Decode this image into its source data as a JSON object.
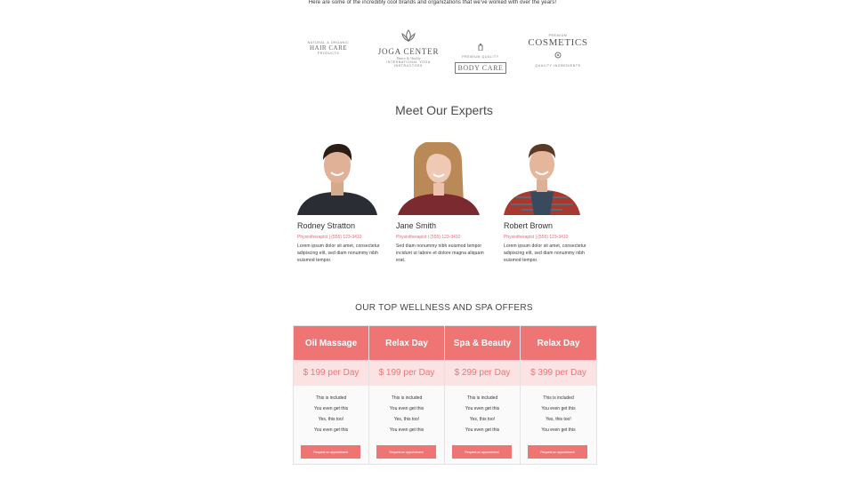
{
  "intro": {
    "text": "Here are some of the incredibly cool brands and organizations that we've worked with over the years!"
  },
  "brands": {
    "hair_care": {
      "top": "NATURAL & ORGANIC",
      "main": "HAIR CARE",
      "bottom": "PRODUCTS"
    },
    "joga_center": {
      "main": "JOGA CENTER",
      "script": "Dance & Vitality",
      "bottom": "INTERNATIONAL YOGA INSTRUCTORS"
    },
    "body_care": {
      "top": "PREMIUM QUALITY",
      "main": "BODY CARE"
    },
    "cosmetics": {
      "top": "PREMIUM",
      "main": "COSMETICS",
      "bottom": "QUALITY INGREDIENTS"
    }
  },
  "experts": {
    "title": "Meet Our Experts",
    "people": [
      {
        "name": "Rodney Stratton",
        "role": "Physiotherapist | (555) 123-3410",
        "bio": "Lorem ipsum dolor sit amet, consectetur adipiscing elit, sed diam nonummy nibh euismod tempor."
      },
      {
        "name": "Jane Smith",
        "role": "Physiotherapist | (555) 123-3410",
        "bio": "Sed diam nonummy nibh euismod tempor incidunt ut labore et dolore magna aliquam erat."
      },
      {
        "name": "Robert Brown",
        "role": "Physiotherapist | (555) 123-3410",
        "bio": "Lorem ipsum dolor sit amet, consectetur adipiscing elit, sed diam nonummy nibh euismod tempor."
      }
    ]
  },
  "offers": {
    "title": "OUR TOP WELLNESS AND SPA OFFERS",
    "plans": [
      {
        "name": "Oil Massage",
        "price": "$ 199 per Day",
        "features": [
          "This is included",
          "You even get this",
          "Yes, this too!",
          "You even get this"
        ],
        "cta": "Request an appointment"
      },
      {
        "name": "Relax Day",
        "price": "$ 199 per Day",
        "features": [
          "This is included",
          "You even get this",
          "Yes, this too!",
          "You even get this"
        ],
        "cta": "Request an appointment"
      },
      {
        "name": "Spa & Beauty",
        "price": "$ 299 per Day",
        "features": [
          "This is included",
          "You even get this",
          "Yes, this too!",
          "You even get this"
        ],
        "cta": "Request an appointment"
      },
      {
        "name": "Relax Day",
        "price": "$ 399 per Day",
        "features": [
          "This is included",
          "You even get this",
          "Yes, this too!",
          "You even get this"
        ],
        "cta": "Request an appointment"
      }
    ]
  },
  "colors": {
    "accent": "#ef7474",
    "accent_light": "#fbe3e3",
    "role_text": "#e8697a"
  }
}
